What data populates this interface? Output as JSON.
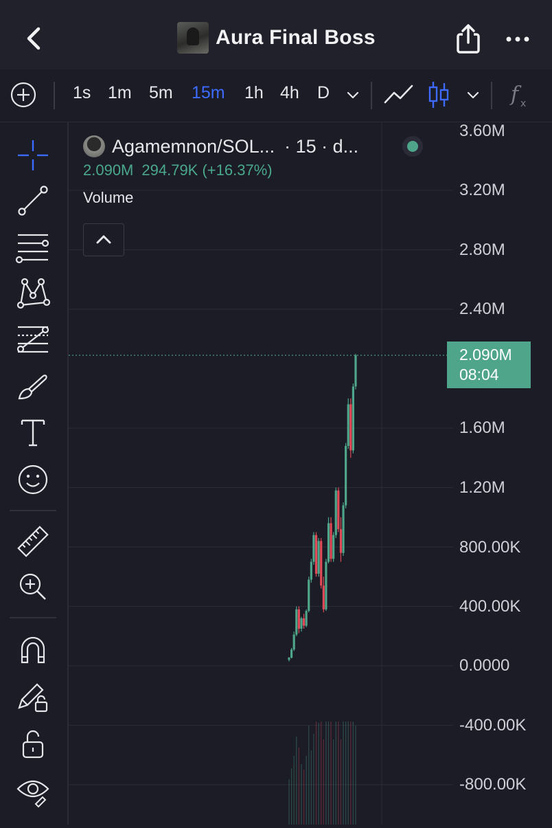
{
  "header": {
    "title": "Aura Final Boss"
  },
  "toolbar": {
    "intervals": [
      {
        "label": "1s",
        "active": false
      },
      {
        "label": "1m",
        "active": false
      },
      {
        "label": "5m",
        "active": false
      },
      {
        "label": "15m",
        "active": true
      },
      {
        "label": "1h",
        "active": false
      },
      {
        "label": "4h",
        "active": false
      },
      {
        "label": "D",
        "active": false
      }
    ],
    "accent_color": "#3d6bff"
  },
  "legend": {
    "symbol": "Agamemnon/SOL...",
    "meta": "· 15 · d...",
    "price": "2.090M",
    "change": "294.79K (+16.37%)",
    "indicator": "Volume",
    "status_color": "#4fa58a"
  },
  "axis": {
    "labels": [
      "3.60M",
      "3.20M",
      "2.80M",
      "2.40M",
      "1.60M",
      "1.20M",
      "800.00K",
      "400.00K",
      "0.0000",
      "-400.00K",
      "-800.00K"
    ]
  },
  "price_tag": {
    "price": "2.090M",
    "countdown": "08:04"
  },
  "tools": [
    "crosshair-icon",
    "trend-line-icon",
    "horizontal-lines-icon",
    "pattern-icon",
    "fib-icon",
    "brush-icon",
    "text-icon",
    "emoji-icon",
    "ruler-icon",
    "zoom-in-icon",
    "magnet-icon",
    "lock-drawing-icon",
    "lock-icon",
    "eye-icon"
  ],
  "chart_data": {
    "type": "candlestick",
    "ylim": [
      -1000000,
      3700000
    ],
    "up_color": "#4fa58a",
    "down_color": "#e04b57",
    "last_price": 2090000,
    "candles": [
      {
        "o": 40000,
        "h": 60000,
        "l": 30000,
        "c": 55000
      },
      {
        "o": 55000,
        "h": 120000,
        "l": 50000,
        "c": 110000
      },
      {
        "o": 110000,
        "h": 230000,
        "l": 100000,
        "c": 210000
      },
      {
        "o": 210000,
        "h": 400000,
        "l": 200000,
        "c": 380000
      },
      {
        "o": 380000,
        "h": 400000,
        "l": 220000,
        "c": 250000
      },
      {
        "o": 250000,
        "h": 330000,
        "l": 230000,
        "c": 320000
      },
      {
        "o": 320000,
        "h": 350000,
        "l": 250000,
        "c": 270000
      },
      {
        "o": 270000,
        "h": 380000,
        "l": 260000,
        "c": 370000
      },
      {
        "o": 370000,
        "h": 600000,
        "l": 360000,
        "c": 580000
      },
      {
        "o": 580000,
        "h": 720000,
        "l": 560000,
        "c": 700000
      },
      {
        "o": 700000,
        "h": 900000,
        "l": 680000,
        "c": 880000
      },
      {
        "o": 880000,
        "h": 900000,
        "l": 600000,
        "c": 620000
      },
      {
        "o": 620000,
        "h": 860000,
        "l": 600000,
        "c": 840000
      },
      {
        "o": 840000,
        "h": 860000,
        "l": 520000,
        "c": 540000
      },
      {
        "o": 540000,
        "h": 600000,
        "l": 360000,
        "c": 380000
      },
      {
        "o": 380000,
        "h": 720000,
        "l": 370000,
        "c": 700000
      },
      {
        "o": 700000,
        "h": 1000000,
        "l": 690000,
        "c": 960000
      },
      {
        "o": 960000,
        "h": 1000000,
        "l": 700000,
        "c": 720000
      },
      {
        "o": 720000,
        "h": 900000,
        "l": 700000,
        "c": 880000
      },
      {
        "o": 880000,
        "h": 1200000,
        "l": 860000,
        "c": 1180000
      },
      {
        "o": 1180000,
        "h": 1200000,
        "l": 900000,
        "c": 920000
      },
      {
        "o": 920000,
        "h": 1000000,
        "l": 700000,
        "c": 760000
      },
      {
        "o": 760000,
        "h": 1100000,
        "l": 740000,
        "c": 1080000
      },
      {
        "o": 1080000,
        "h": 1500000,
        "l": 1060000,
        "c": 1480000
      },
      {
        "o": 1480000,
        "h": 1800000,
        "l": 1460000,
        "c": 1760000
      },
      {
        "o": 1760000,
        "h": 1800000,
        "l": 1400000,
        "c": 1450000
      },
      {
        "o": 1450000,
        "h": 1900000,
        "l": 1430000,
        "c": 1880000
      },
      {
        "o": 1880000,
        "h": 2100000,
        "l": 1860000,
        "c": 2090000
      }
    ]
  }
}
